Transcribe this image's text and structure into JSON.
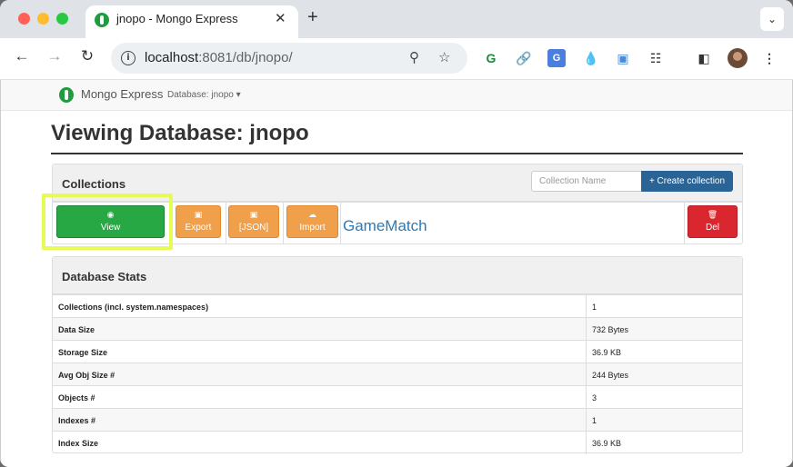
{
  "browser": {
    "tab_title": "jnopo - Mongo Express",
    "tab_close": "✕",
    "new_tab": "+",
    "tab_menu": "⌄",
    "url_host": "localhost",
    "url_path": ":8081/db/jnopo/"
  },
  "app": {
    "brand": "Mongo Express",
    "db_menu": "Database: jnopo ▾"
  },
  "page": {
    "title": "Viewing Database: jnopo"
  },
  "collections": {
    "header": "Collections",
    "name_placeholder": "Collection Name",
    "create_label": "+ Create collection",
    "rows": [
      {
        "name": "GameMatch",
        "view_label": "View",
        "export_label": "Export",
        "json_label": "[JSON]",
        "import_label": "Import",
        "del_label": "Del"
      }
    ]
  },
  "stats": {
    "header": "Database Stats",
    "rows": [
      {
        "label": "Collections (incl. system.namespaces)",
        "value": "1"
      },
      {
        "label": "Data Size",
        "value": "732 Bytes"
      },
      {
        "label": "Storage Size",
        "value": "36.9 KB"
      },
      {
        "label": "Avg Obj Size #",
        "value": "244 Bytes"
      },
      {
        "label": "Objects #",
        "value": "3"
      },
      {
        "label": "Indexes #",
        "value": "1"
      },
      {
        "label": "Index Size",
        "value": "36.9 KB"
      }
    ]
  },
  "colors": {
    "view": "#28a745",
    "orange": "#f0a04a",
    "delete": "#d9262f",
    "primary": "#2a6496",
    "highlight": "#e6fb55"
  },
  "icons": {
    "view": "eye-icon",
    "export": "floppy-icon",
    "json": "floppy-icon",
    "import": "cloud-upload-icon",
    "del": "trash-icon"
  }
}
